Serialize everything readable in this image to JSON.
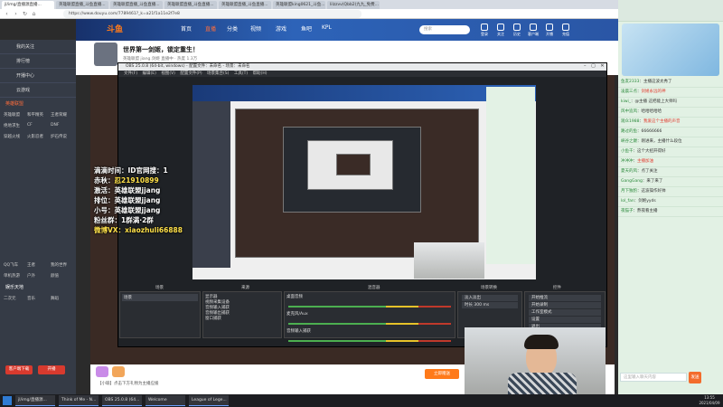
{
  "browser": {
    "tabs": [
      "jl/img/直播源直播...",
      "英雄联盟直播_斗鱼直播...",
      "英雄联盟直播_斗鱼直播...",
      "英雄联盟直播_斗鱼直播...",
      "英雄联盟直播_斗鱼直播...",
      "英雄联盟king0621_斗鱼...",
      "lilzzvv(Qbb2)九九_免费..."
    ],
    "url": "https://www.douyu.com/7789461?_k=a21f1a11e2f7e8"
  },
  "site": {
    "logo": "斗鱼",
    "nav": [
      "首页",
      "直播",
      "分类",
      "视频",
      "游戏",
      "鱼吧",
      "KPL"
    ],
    "search_placeholder": "搜索",
    "header_icons": [
      "登录",
      "关注",
      "历史",
      "客户端",
      "开播",
      "充值"
    ]
  },
  "sidebar": {
    "top_items": [
      "我的关注",
      "排行榜",
      "开播中心",
      "云游戏"
    ],
    "section_hot": "英雄联盟",
    "grid": [
      "英雄联盟",
      "和平精英",
      "王者荣耀",
      "绝地求生",
      "CF",
      "DNF",
      "穿越火线",
      "火影忍者",
      "炉石传说",
      "QQ飞车",
      "王者",
      "我的世界",
      "单机热游",
      "户外",
      "颜值",
      "二次元",
      "音乐",
      "舞蹈"
    ],
    "section_more": "娱乐天地",
    "buttons": [
      "客户端下载",
      "开播"
    ]
  },
  "stream": {
    "title": "世界第一剑姬，锁定重生！",
    "subtitle": "英雄联盟  jiang.剑姬  直播中  ·  热度 1.3万"
  },
  "scores": [
    {
      "label": "滴滴时间：",
      "value": "ID官网搜：1"
    },
    {
      "label": "赤秋：",
      "value": "忍21910899"
    },
    {
      "label": "激活：",
      "value": "英雄联盟jjang"
    },
    {
      "label": "排位：",
      "value": "英雄联盟jjang"
    },
    {
      "label": "小号：",
      "value": "英雄联盟jjang"
    },
    {
      "label": "粉丝群：",
      "value": "1群满·2群"
    },
    {
      "label": "微博VX：",
      "value": "xiaozhuli66888"
    }
  ],
  "obs": {
    "title": "OBS 25.0.8 (64-bit, windows) - 配置文件：未命名 - 场景：未命名",
    "menu": [
      "文件(F)",
      "编辑(E)",
      "视图(V)",
      "配置文件(P)",
      "场景集合(S)",
      "工具(T)",
      "帮助(H)"
    ],
    "docks": [
      "场景",
      "来源",
      "混音器",
      "场景转换",
      "控件"
    ],
    "scene": "场景",
    "sources": [
      "显示器",
      "视频采集设备",
      "音频输入捕获",
      "音频输出捕获",
      "窗口捕获"
    ],
    "mixer": [
      "桌面音频",
      "麦克风/Aux",
      "音频输入捕获"
    ],
    "transition": "淡入淡出",
    "transition_duration": "时长  300 ms",
    "controls": [
      "开始推流",
      "开始录制",
      "工作室模式",
      "设置",
      "退出"
    ]
  },
  "gift": {
    "hint": "【小瑜】点击下方礼物为主播应援",
    "cta": "立即赠送"
  },
  "chat": {
    "messages": [
      {
        "user": "鱼友2333",
        "text": "主播这波太秀了"
      },
      {
        "user": "凌晨三点",
        "text": "剑姬永远的神"
      },
      {
        "user": "kiwi_",
        "text": "@主播 这把能上大师吗"
      },
      {
        "user": "风中追风",
        "text": "哈哈哈哈哈"
      },
      {
        "user": "观众1988",
        "text": "我爱这个主播的声音"
      },
      {
        "user": "路过的鱼",
        "text": "66666666"
      },
      {
        "user": "峡谷之巅",
        "text": "刚进来，主播什么段位"
      },
      {
        "user": "小鱼干",
        "text": "这个大招开得好"
      },
      {
        "user": "冲冲冲",
        "text": "主播加油"
      },
      {
        "user": "夏天的风",
        "text": "点了关注"
      },
      {
        "user": "GangGang",
        "text": "来了来了"
      },
      {
        "user": "月下独酌",
        "text": "这波操作好帅"
      },
      {
        "user": "lol_fan",
        "text": "剑姬yyds"
      },
      {
        "user": "夜猫子",
        "text": "熬夜看主播"
      }
    ],
    "input_placeholder": "这里输入聊天内容",
    "send": "发送"
  },
  "taskbar": {
    "items": [
      "jl/img/直播源...",
      "Think of Me - N...",
      "OBS 25.0.8 (64...",
      "Welcome",
      "League of Lege..."
    ],
    "time": "13:55",
    "date": "2021/04/09"
  }
}
